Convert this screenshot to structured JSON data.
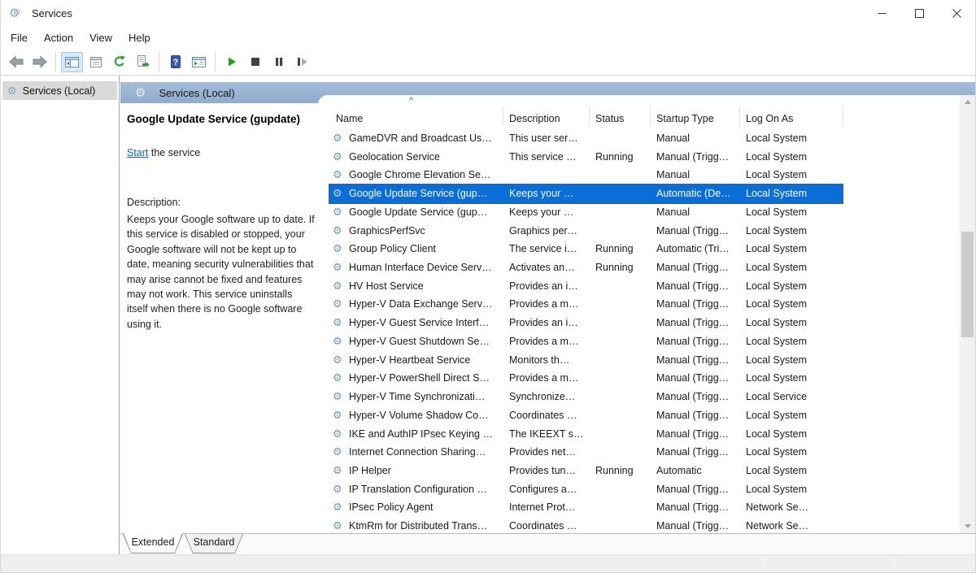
{
  "window": {
    "title": "Services"
  },
  "menu": {
    "items": [
      "File",
      "Action",
      "View",
      "Help"
    ]
  },
  "toolbar": {
    "icons": [
      "back",
      "forward",
      "show-console-tree",
      "properties",
      "refresh",
      "export-list",
      "help",
      "extended-standard-view",
      "start-service",
      "stop-service",
      "pause-service",
      "restart-service"
    ],
    "active_icon": "show-console-tree",
    "help_glyph": "?"
  },
  "tree": {
    "root_label": "Services (Local)"
  },
  "banner": {
    "label": "Services (Local)"
  },
  "service_detail": {
    "title": "Google Update Service (gupdate)",
    "action_link": "Start",
    "action_suffix": " the service",
    "description_label": "Description:",
    "description_text": "Keeps your Google software up to date. If this service is disabled or stopped, your Google software will not be kept up to date, meaning security vulnerabilities that may arise cannot be fixed and features may not work. This service uninstalls itself when there is no Google software using it."
  },
  "table": {
    "sort_indicator": "^",
    "sorted_column": "Name",
    "columns": [
      "Name",
      "Description",
      "Status",
      "Startup Type",
      "Log On As"
    ],
    "rows": [
      {
        "name": "GameDVR and Broadcast Us…",
        "description": "This user ser…",
        "status": "",
        "startup_type": "Manual",
        "log_on_as": "Local System",
        "selected": false
      },
      {
        "name": "Geolocation Service",
        "description": "This service …",
        "status": "Running",
        "startup_type": "Manual (Trigg…",
        "log_on_as": "Local System",
        "selected": false
      },
      {
        "name": "Google Chrome Elevation Se…",
        "description": "",
        "status": "",
        "startup_type": "Manual",
        "log_on_as": "Local System",
        "selected": false
      },
      {
        "name": "Google Update Service (gup…",
        "description": "Keeps your …",
        "status": "",
        "startup_type": "Automatic (De…",
        "log_on_as": "Local System",
        "selected": true
      },
      {
        "name": "Google Update Service (gup…",
        "description": "Keeps your …",
        "status": "",
        "startup_type": "Manual",
        "log_on_as": "Local System",
        "selected": false
      },
      {
        "name": "GraphicsPerfSvc",
        "description": "Graphics per…",
        "status": "",
        "startup_type": "Manual (Trigg…",
        "log_on_as": "Local System",
        "selected": false
      },
      {
        "name": "Group Policy Client",
        "description": "The service i…",
        "status": "Running",
        "startup_type": "Automatic (Tri…",
        "log_on_as": "Local System",
        "selected": false
      },
      {
        "name": "Human Interface Device Serv…",
        "description": "Activates an…",
        "status": "Running",
        "startup_type": "Manual (Trigg…",
        "log_on_as": "Local System",
        "selected": false
      },
      {
        "name": "HV Host Service",
        "description": "Provides an i…",
        "status": "",
        "startup_type": "Manual (Trigg…",
        "log_on_as": "Local System",
        "selected": false
      },
      {
        "name": "Hyper-V Data Exchange Serv…",
        "description": "Provides a m…",
        "status": "",
        "startup_type": "Manual (Trigg…",
        "log_on_as": "Local System",
        "selected": false
      },
      {
        "name": "Hyper-V Guest Service Interf…",
        "description": "Provides an i…",
        "status": "",
        "startup_type": "Manual (Trigg…",
        "log_on_as": "Local System",
        "selected": false
      },
      {
        "name": "Hyper-V Guest Shutdown Se…",
        "description": "Provides a m…",
        "status": "",
        "startup_type": "Manual (Trigg…",
        "log_on_as": "Local System",
        "selected": false
      },
      {
        "name": "Hyper-V Heartbeat Service",
        "description": "Monitors th…",
        "status": "",
        "startup_type": "Manual (Trigg…",
        "log_on_as": "Local System",
        "selected": false
      },
      {
        "name": "Hyper-V PowerShell Direct S…",
        "description": "Provides a m…",
        "status": "",
        "startup_type": "Manual (Trigg…",
        "log_on_as": "Local System",
        "selected": false
      },
      {
        "name": "Hyper-V Time Synchronizati…",
        "description": "Synchronize…",
        "status": "",
        "startup_type": "Manual (Trigg…",
        "log_on_as": "Local Service",
        "selected": false
      },
      {
        "name": "Hyper-V Volume Shadow Co…",
        "description": "Coordinates …",
        "status": "",
        "startup_type": "Manual (Trigg…",
        "log_on_as": "Local System",
        "selected": false
      },
      {
        "name": "IKE and AuthIP IPsec Keying …",
        "description": "The IKEEXT s…",
        "status": "",
        "startup_type": "Manual (Trigg…",
        "log_on_as": "Local System",
        "selected": false
      },
      {
        "name": "Internet Connection Sharing…",
        "description": "Provides net…",
        "status": "",
        "startup_type": "Manual (Trigg…",
        "log_on_as": "Local System",
        "selected": false
      },
      {
        "name": "IP Helper",
        "description": "Provides tun…",
        "status": "Running",
        "startup_type": "Automatic",
        "log_on_as": "Local System",
        "selected": false
      },
      {
        "name": "IP Translation Configuration …",
        "description": "Configures a…",
        "status": "",
        "startup_type": "Manual (Trigg…",
        "log_on_as": "Local System",
        "selected": false
      },
      {
        "name": "IPsec Policy Agent",
        "description": "Internet Prot…",
        "status": "",
        "startup_type": "Manual (Trigg…",
        "log_on_as": "Network Se…",
        "selected": false
      },
      {
        "name": "KtmRm for Distributed Trans…",
        "description": "Coordinates …",
        "status": "",
        "startup_type": "Manual (Trigg…",
        "log_on_as": "Network Se…",
        "selected": false
      }
    ]
  },
  "tabs": {
    "items": [
      "Extended",
      "Standard"
    ],
    "active": "Extended"
  },
  "colors": {
    "selection": "#0a6ed6",
    "banner": "#9bb4d3",
    "toolbar_active_bg": "#d7e9fb",
    "link": "#0b63c5",
    "tree_highlight": "#d9d9d9"
  }
}
